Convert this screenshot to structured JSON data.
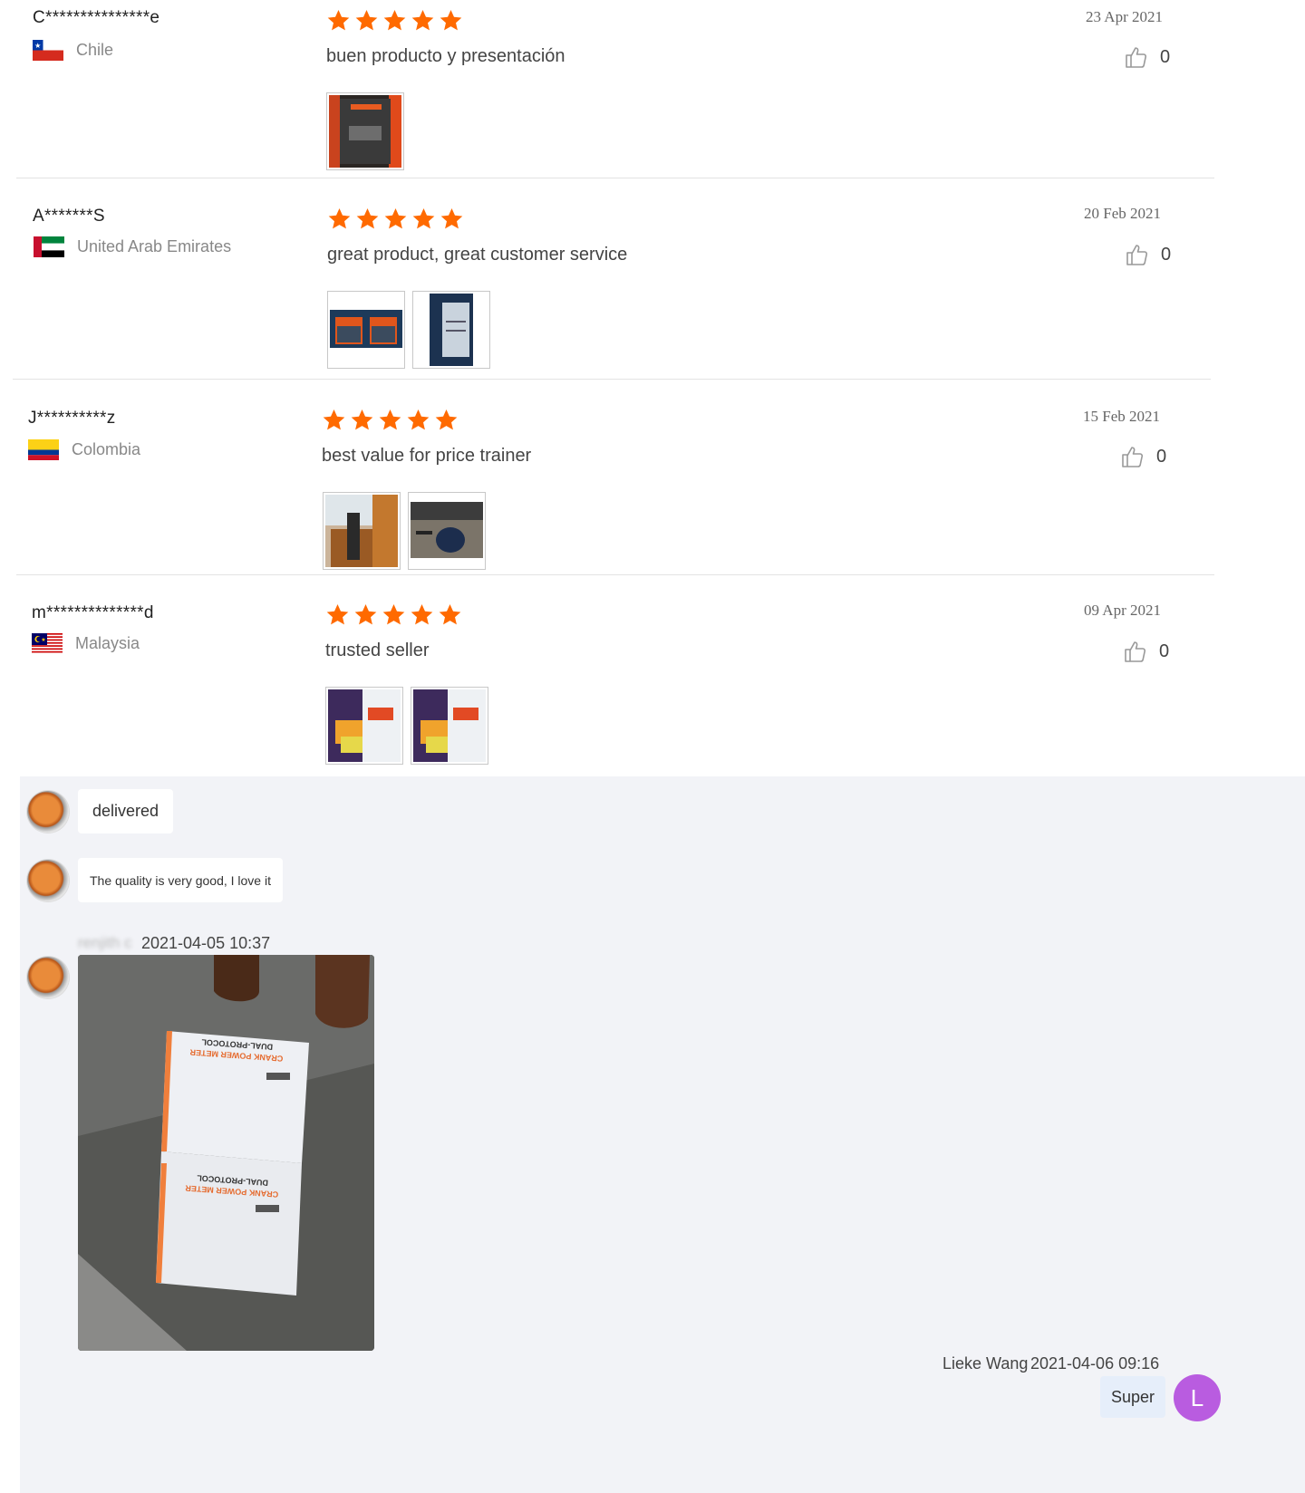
{
  "reviews": [
    {
      "name": "C***************e",
      "country": "Chile",
      "text": "buen producto y presentación",
      "date": "23 Apr 2021",
      "likes": "0",
      "rating": 5
    },
    {
      "name": "A*******S",
      "country": "United Arab Emirates",
      "text": "great product, great customer service",
      "date": "20  Feb 2021",
      "likes": "0",
      "rating": 5
    },
    {
      "name": "J**********z",
      "country": "Colombia",
      "text": "best value for price trainer",
      "date": "15 Feb 2021",
      "likes": "0",
      "rating": 5
    },
    {
      "name": "m**************d",
      "country": "Malaysia",
      "text": "trusted seller",
      "date": "09 Apr 2021",
      "likes": "0",
      "rating": 5
    }
  ],
  "chat": {
    "messages": [
      {
        "text": "delivered"
      },
      {
        "text": "The quality is very good, I love it"
      }
    ],
    "photo_message": {
      "sender": "renjith c",
      "time": "2021-04-05 10:37",
      "box_label_1": "CRANK POWER METER",
      "box_label_2": "DUAL-PROTOCOL"
    },
    "reply": {
      "sender": "Lieke Wang",
      "time": "2021-04-06 09:16",
      "text": "Super",
      "avatar_letter": "L"
    }
  },
  "colors": {
    "star": "#ff6a00",
    "reply_avatar": "#b95ce0",
    "reply_bubble": "#e6eefa",
    "chat_bg": "#f2f3f7"
  },
  "icons": [
    "star-icon",
    "thumbs-up-icon",
    "flag-icon"
  ]
}
